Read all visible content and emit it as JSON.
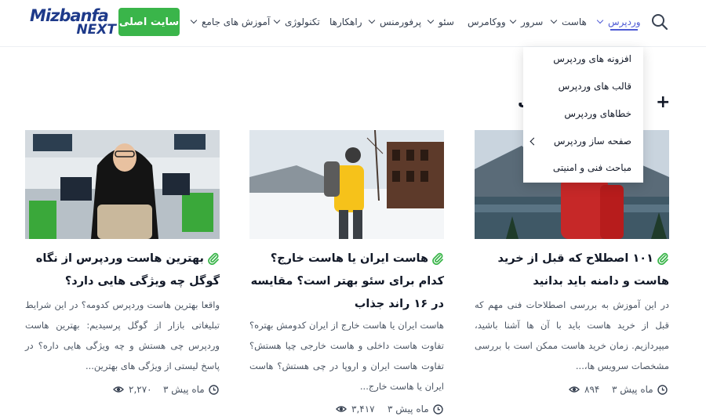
{
  "header": {
    "logo_line1": "Mizbanfa",
    "logo_line2": "NEXT",
    "site_button": "سایت اصلی",
    "nav": [
      {
        "label": "وردپرس",
        "dropdown": true,
        "active": true
      },
      {
        "label": "هاست",
        "dropdown": true
      },
      {
        "label": "سرور",
        "dropdown": true
      },
      {
        "label": "ووکامرس",
        "dropdown": false
      },
      {
        "label": "سئو",
        "dropdown": true
      },
      {
        "label": "پرفورمنس",
        "dropdown": true
      },
      {
        "label": "راهکارها",
        "dropdown": false
      },
      {
        "label": "تکنولوژی",
        "dropdown": true
      },
      {
        "label": "آموزش های جامع",
        "dropdown": true
      }
    ],
    "search_icon": "search-icon"
  },
  "dropdown": {
    "items": [
      {
        "label": "افزونه های وردپرس"
      },
      {
        "label": "قالب های وردپرس"
      },
      {
        "label": "خطاهای وردپرس"
      },
      {
        "label": "صفحه ساز وردپرس",
        "submenu": true
      },
      {
        "label": "مباحث فنی و امنیتی"
      }
    ]
  },
  "section": {
    "title": "پ",
    "icon": "plus-icon"
  },
  "cards": [
    {
      "title": "۱۰۱ اصطلاح که قبل از خرید هاست و دامنه باید بدانید",
      "excerpt": "در این آموزش به بررسی اصطلاحات فنی مهم که قبل از خرید هاست باید با آن ها آشنا باشید، میپردازیم. زمان خرید هاست ممکن است با بررسی مشخصات سرویس ها،...",
      "time": "۳ ماه پیش",
      "views": "۸۹۴"
    },
    {
      "title": "هاست ایران یا هاست خارج؟ کدام برای سئو بهتر است؟ مقایسه در ۱۶ راند جذاب",
      "excerpt": "هاست ایران یا هاست خارج از ایران کدومش بهتره؟ تفاوت هاست داخلی و هاست خارجی چیا هستش؟ تفاوت هاست ایران و اروپا در چی هستش؟ هاست ایران یا هاست خارج...",
      "time": "۳ ماه پیش",
      "views": "۳,۴۱۷"
    },
    {
      "title": "بهترین هاست وردپرس از نگاه گوگل چه ویژگی هایی دارد؟",
      "excerpt": "واقعا بهترین هاست وردپرس کدومه؟ در این شرایط تبلیغاتی بازار از گوگل پرسیدیم: بهترین هاست وردپرس چی هستش و چه ویژگی هایی داره؟ در پاسخ لیستی از ویژگی های بهترین...",
      "time": "۳ ماه پیش",
      "views": "۲,۲۷۰"
    }
  ],
  "colors": {
    "accent": "#4f5bd5",
    "button_green": "#3ab54a",
    "logo_blue": "#1e3a8a",
    "clip_green": "#3ab54a"
  }
}
